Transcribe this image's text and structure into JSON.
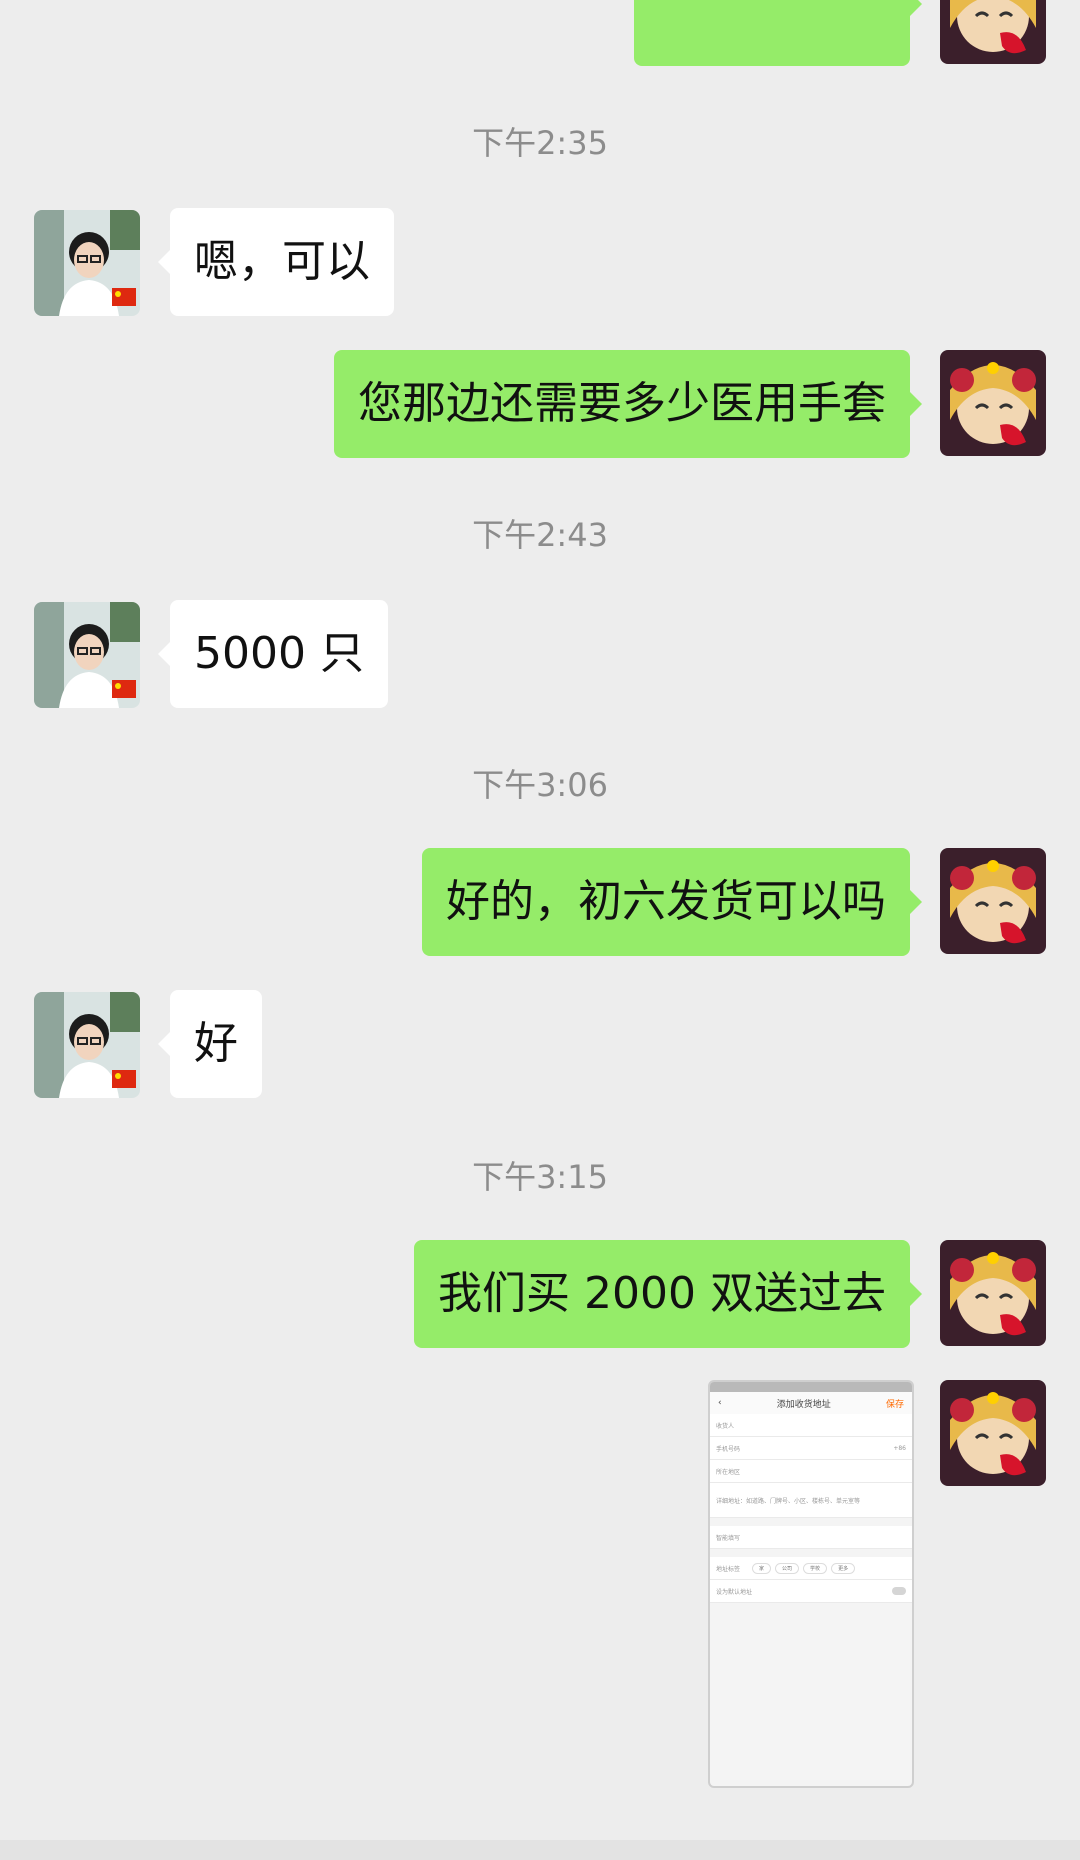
{
  "chat": {
    "partial_message": {
      "sender": "me",
      "text": ""
    },
    "timestamps": [
      "下午2:35",
      "下午2:43",
      "下午3:06",
      "下午3:15"
    ],
    "messages": [
      {
        "sender": "other",
        "text": "嗯，可以"
      },
      {
        "sender": "me",
        "text": "您那边还需要多少医用手套"
      },
      {
        "sender": "other",
        "text": "5000 只"
      },
      {
        "sender": "me",
        "text": "好的，初六发货可以吗"
      },
      {
        "sender": "other",
        "text": "好"
      },
      {
        "sender": "me",
        "text": "我们买 2000 双送过去"
      }
    ],
    "image_message": {
      "sender": "me",
      "screen_title": "添加收货地址",
      "save_label": "保存",
      "fields": [
        "收货人",
        "手机号码",
        "所在地区",
        "详细地址：如道路、门牌号、小区、楼栋号、单元室等",
        "智能填写",
        "地址标签",
        "设为默认地址"
      ],
      "phone_prefix": "+86",
      "tags": [
        "家",
        "公司",
        "学校",
        "更多"
      ]
    }
  },
  "colors": {
    "background": "#ededed",
    "my_bubble": "#95ec69",
    "their_bubble": "#ffffff",
    "timestamp_text": "#8c8c8c"
  }
}
